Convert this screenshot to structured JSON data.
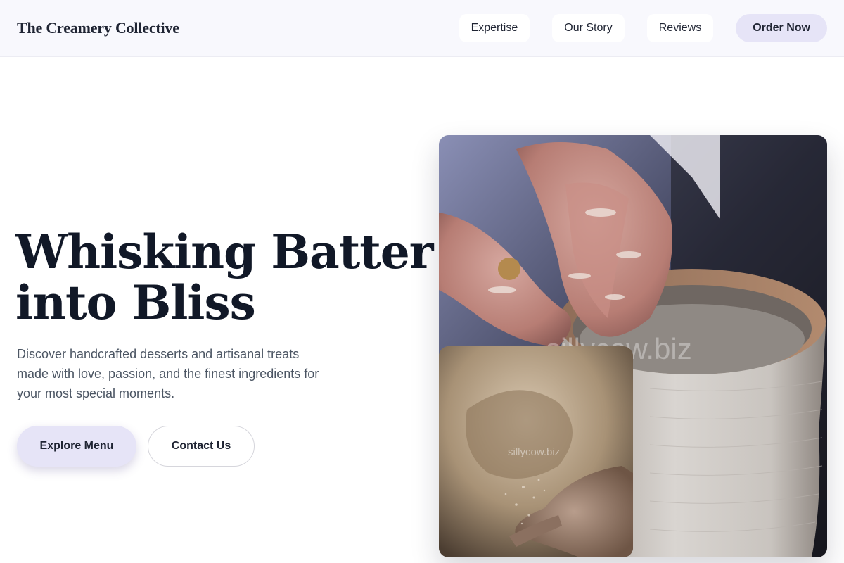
{
  "header": {
    "brand": "The Creamery Collective",
    "nav": [
      "Expertise",
      "Our Story",
      "Reviews"
    ],
    "cta_label": "Order Now"
  },
  "hero": {
    "title_line1": "Whisking Batter",
    "title_line2": "into Bliss",
    "description": "Discover handcrafted desserts and artisanal treats made with love, passion, and the finest ingredients for your most special moments.",
    "primary_button": "Explore Menu",
    "secondary_button": "Contact Us"
  },
  "images": {
    "main_watermark": "sillycow.biz",
    "inset_watermark": "sillycow.biz"
  },
  "colors": {
    "accent": "#e6e4f7",
    "heading": "#111827",
    "body_text": "#4b5563",
    "header_bg": "#f8f8fd"
  }
}
